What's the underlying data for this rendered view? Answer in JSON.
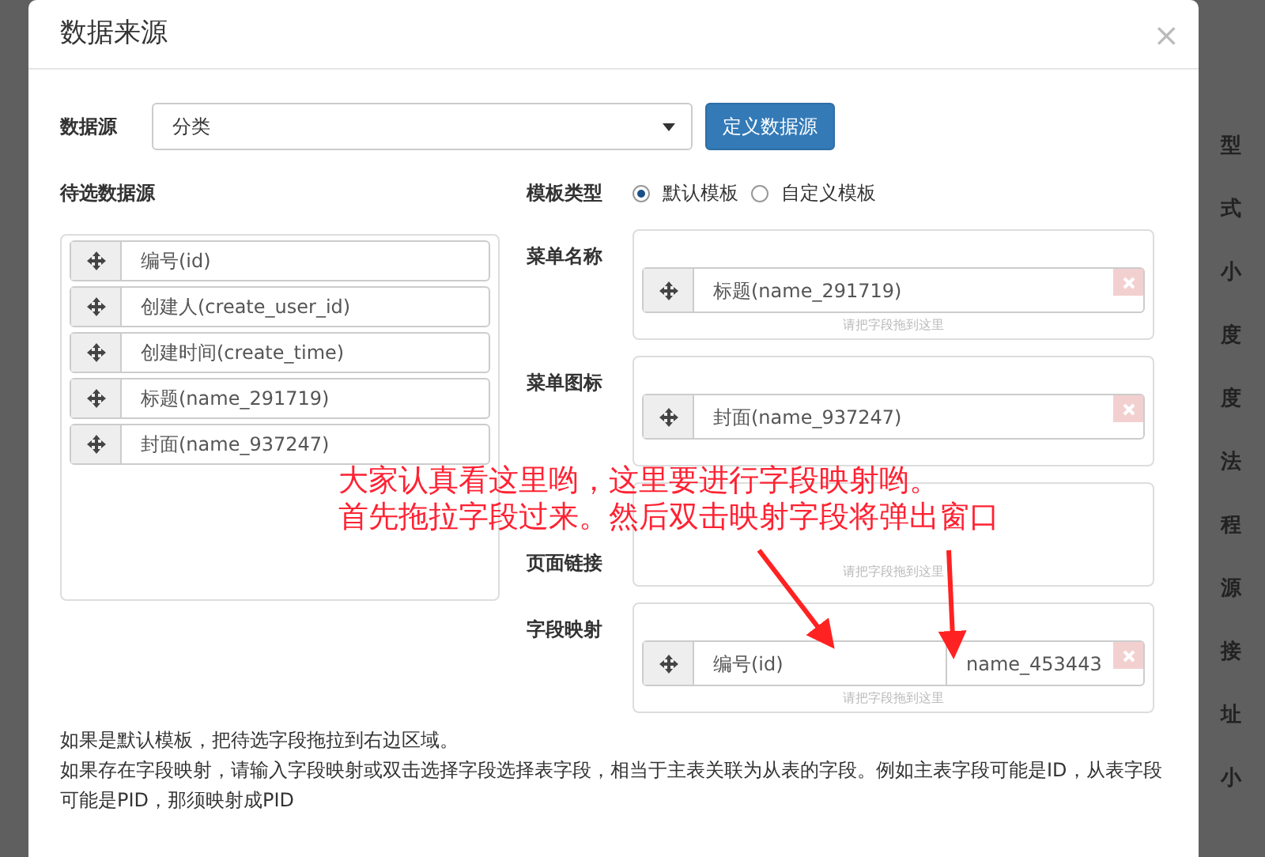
{
  "background_labels": [
    "型",
    "式",
    "小",
    "度",
    "度",
    "法",
    "程",
    "源",
    "接",
    "址",
    "小"
  ],
  "dialog": {
    "title": "数据来源",
    "close": "×"
  },
  "datasource": {
    "label": "数据源",
    "value": "分类",
    "button": "定义数据源"
  },
  "candidates": {
    "title": "待选数据源",
    "fields": [
      {
        "label": "编号(id)"
      },
      {
        "label": "创建人(create_user_id)"
      },
      {
        "label": "创建时间(create_time)"
      },
      {
        "label": "标题(name_291719)"
      },
      {
        "label": "封面(name_937247)"
      }
    ]
  },
  "template_type": {
    "label": "模板类型",
    "options": [
      {
        "label": "默认模板",
        "selected": true
      },
      {
        "label": "自定义模板",
        "selected": false
      }
    ]
  },
  "targets": [
    {
      "label": "菜单名称",
      "hint": "请把字段拖到这里",
      "fields": [
        {
          "label": "标题(name_291719)"
        }
      ]
    },
    {
      "label": "菜单图标",
      "fields": [
        {
          "label": "封面(name_937247)"
        }
      ]
    },
    {
      "label": "页面链接",
      "hint": "请把字段拖到这里"
    },
    {
      "label": "字段映射",
      "hint": "请把字段拖到这里",
      "fields": [
        {
          "label": "编号(id)",
          "mapping": "name_453443"
        }
      ]
    }
  ],
  "notes": [
    "如果是默认模板，把待选字段拖拉到右边区域。",
    "如果存在字段映射，请输入字段映射或双击选择字段选择表字段，相当于主表关联为从表的字段。例如主表字段可能是ID，从表字段可能是PID，那须映射成PID"
  ],
  "annotation": [
    "大家认真看这里哟，这里要进行字段映射哟。",
    "首先拖拉字段过来。然后双击映射字段将弹出窗口"
  ]
}
